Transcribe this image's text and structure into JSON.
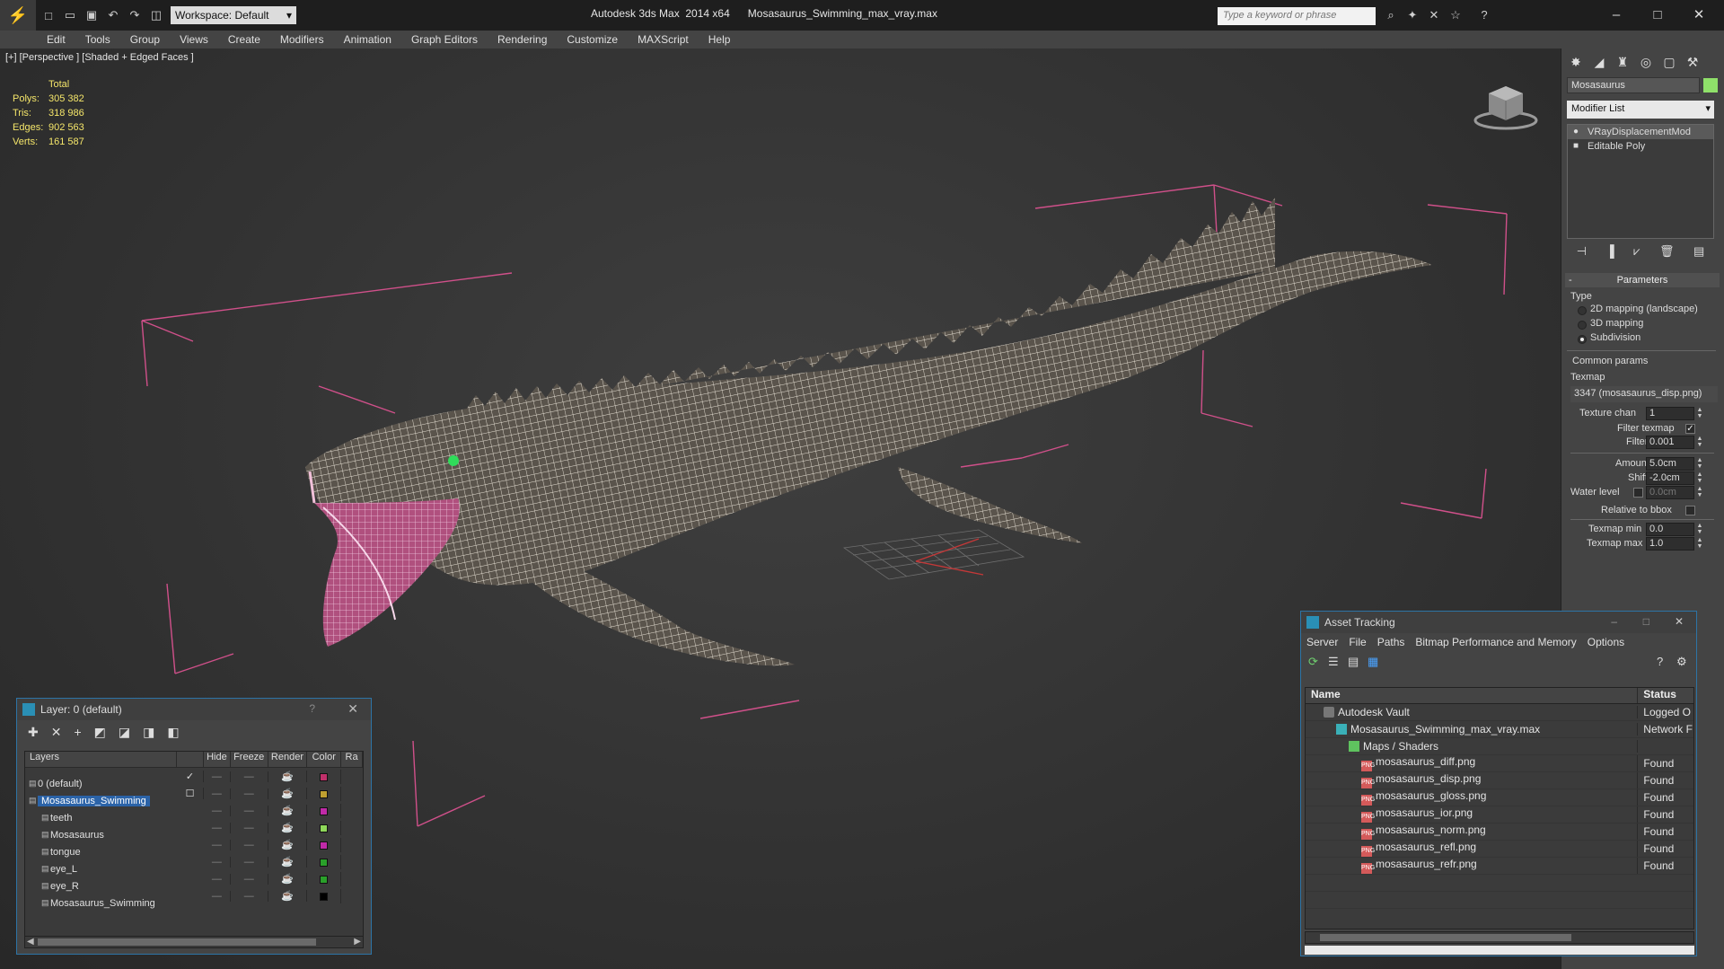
{
  "app": {
    "title": "Autodesk 3ds Max  2014 x64",
    "file": "Mosasaurus_Swimming_max_vray.max",
    "workspace": "Workspace: Default",
    "search_placeholder": "Type a keyword or phrase"
  },
  "menu": [
    "Edit",
    "Tools",
    "Group",
    "Views",
    "Create",
    "Modifiers",
    "Animation",
    "Graph Editors",
    "Rendering",
    "Customize",
    "MAXScript",
    "Help"
  ],
  "viewport": {
    "label": "[+] [Perspective ] [Shaded + Edged Faces ]",
    "stats": {
      "header": "Total",
      "rows": [
        {
          "k": "Polys:",
          "v": "305 382"
        },
        {
          "k": "Tris:",
          "v": "318 986"
        },
        {
          "k": "Edges:",
          "v": "902 563"
        },
        {
          "k": "Verts:",
          "v": "161 587"
        }
      ]
    }
  },
  "command_panel": {
    "object_name": "Mosasaurus",
    "object_color": "#8fe06a",
    "modifier_list": "Modifier List",
    "stack": [
      "VRayDisplacementMod",
      "Editable Poly"
    ],
    "params_header": "Parameters",
    "type_label": "Type",
    "types": [
      {
        "label": "2D mapping (landscape)",
        "on": false
      },
      {
        "label": "3D mapping",
        "on": false
      },
      {
        "label": "Subdivision",
        "on": true
      }
    ],
    "common_params": "Common params",
    "texmap_label": "Texmap",
    "texmap_value": "3347 (mosasaurus_disp.png)",
    "texture_chan_label": "Texture chan",
    "texture_chan": "1",
    "filter_texmap_label": "Filter texmap",
    "filter_blur_label": "Filter blur",
    "filter_blur": "0.001",
    "amount_label": "Amount",
    "amount": "5.0cm",
    "shift_label": "Shift",
    "shift": "-2.0cm",
    "water_level_label": "Water level",
    "water_level": "0.0cm",
    "relative_bbox_label": "Relative to bbox",
    "texmap_min_label": "Texmap min",
    "texmap_min": "0.0",
    "texmap_max_label": "Texmap max",
    "texmap_max": "1.0"
  },
  "layer_window": {
    "title": "Layer: 0 (default)",
    "columns": [
      "Layers",
      "Hide",
      "Freeze",
      "Render",
      "Color",
      "Ra"
    ],
    "rows": [
      {
        "name": "0 (default)",
        "indent": 0,
        "active": true,
        "color": "#c0306a",
        "selected": false
      },
      {
        "name": "Mosasaurus_Swimming",
        "indent": 0,
        "active": false,
        "color": "#c0a030",
        "selected": true
      },
      {
        "name": "teeth",
        "indent": 1,
        "active": false,
        "color": "#c02aa8",
        "selected": false
      },
      {
        "name": "Mosasaurus",
        "indent": 1,
        "active": false,
        "color": "#8fd85a",
        "selected": false
      },
      {
        "name": "tongue",
        "indent": 1,
        "active": false,
        "color": "#c02aa8",
        "selected": false
      },
      {
        "name": "eye_L",
        "indent": 1,
        "active": false,
        "color": "#2aa02a",
        "selected": false
      },
      {
        "name": "eye_R",
        "indent": 1,
        "active": false,
        "color": "#2aa02a",
        "selected": false
      },
      {
        "name": "Mosasaurus_Swimming",
        "indent": 1,
        "active": false,
        "color": "#000000",
        "selected": false
      }
    ]
  },
  "asset_window": {
    "title": "Asset Tracking",
    "menu": [
      "Server",
      "File",
      "Paths",
      "Bitmap Performance and Memory",
      "Options"
    ],
    "columns": [
      "Name",
      "Status"
    ],
    "rows": [
      {
        "name": "Autodesk Vault",
        "status": "Logged O",
        "indent": 1,
        "icon": "vault"
      },
      {
        "name": "Mosasaurus_Swimming_max_vray.max",
        "status": "Network F",
        "indent": 2,
        "icon": "max"
      },
      {
        "name": "Maps / Shaders",
        "status": "",
        "indent": 3,
        "icon": "maps"
      },
      {
        "name": "mosasaurus_diff.png",
        "status": "Found",
        "indent": 4,
        "icon": "png"
      },
      {
        "name": "mosasaurus_disp.png",
        "status": "Found",
        "indent": 4,
        "icon": "png"
      },
      {
        "name": "mosasaurus_gloss.png",
        "status": "Found",
        "indent": 4,
        "icon": "png"
      },
      {
        "name": "mosasaurus_ior.png",
        "status": "Found",
        "indent": 4,
        "icon": "png"
      },
      {
        "name": "mosasaurus_norm.png",
        "status": "Found",
        "indent": 4,
        "icon": "png"
      },
      {
        "name": "mosasaurus_refl.png",
        "status": "Found",
        "indent": 4,
        "icon": "png"
      },
      {
        "name": "mosasaurus_refr.png",
        "status": "Found",
        "indent": 4,
        "icon": "png"
      }
    ]
  }
}
